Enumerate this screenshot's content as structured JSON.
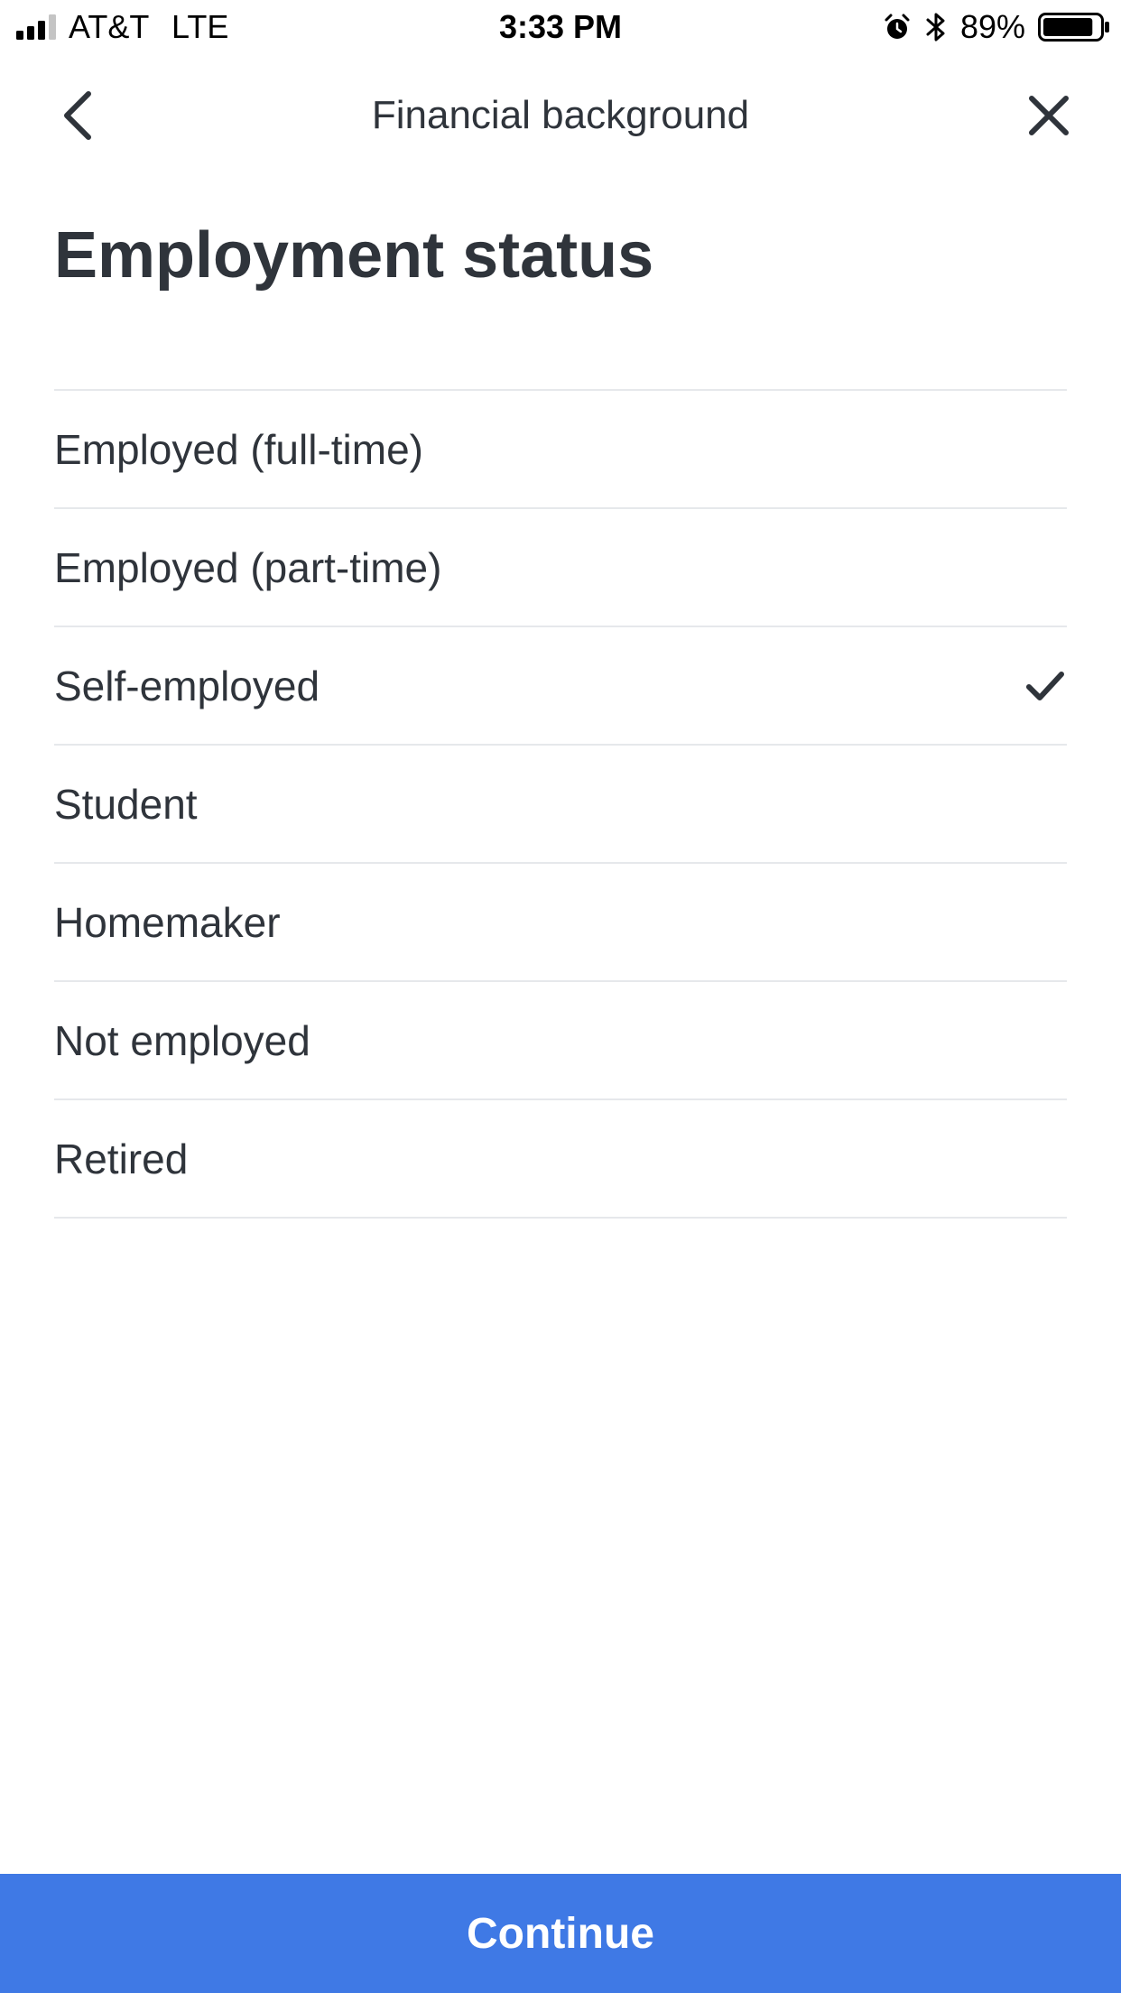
{
  "status_bar": {
    "carrier": "AT&T",
    "network": "LTE",
    "time": "3:33 PM",
    "battery_percent": "89%",
    "battery_level": 0.89,
    "icons": [
      "signal-icon",
      "alarm-icon",
      "bluetooth-icon",
      "battery-icon"
    ]
  },
  "nav": {
    "title": "Financial background",
    "back_icon": "chevron-left-icon",
    "close_icon": "close-icon"
  },
  "page": {
    "title": "Employment status"
  },
  "options": [
    {
      "label": "Employed (full-time)",
      "selected": false
    },
    {
      "label": "Employed (part-time)",
      "selected": false
    },
    {
      "label": "Self-employed",
      "selected": true
    },
    {
      "label": "Student",
      "selected": false
    },
    {
      "label": "Homemaker",
      "selected": false
    },
    {
      "label": "Not employed",
      "selected": false
    },
    {
      "label": "Retired",
      "selected": false
    }
  ],
  "footer": {
    "continue_label": "Continue"
  },
  "colors": {
    "accent": "#3f79e5",
    "text": "#2f343b",
    "divider": "#e6e8eb"
  }
}
